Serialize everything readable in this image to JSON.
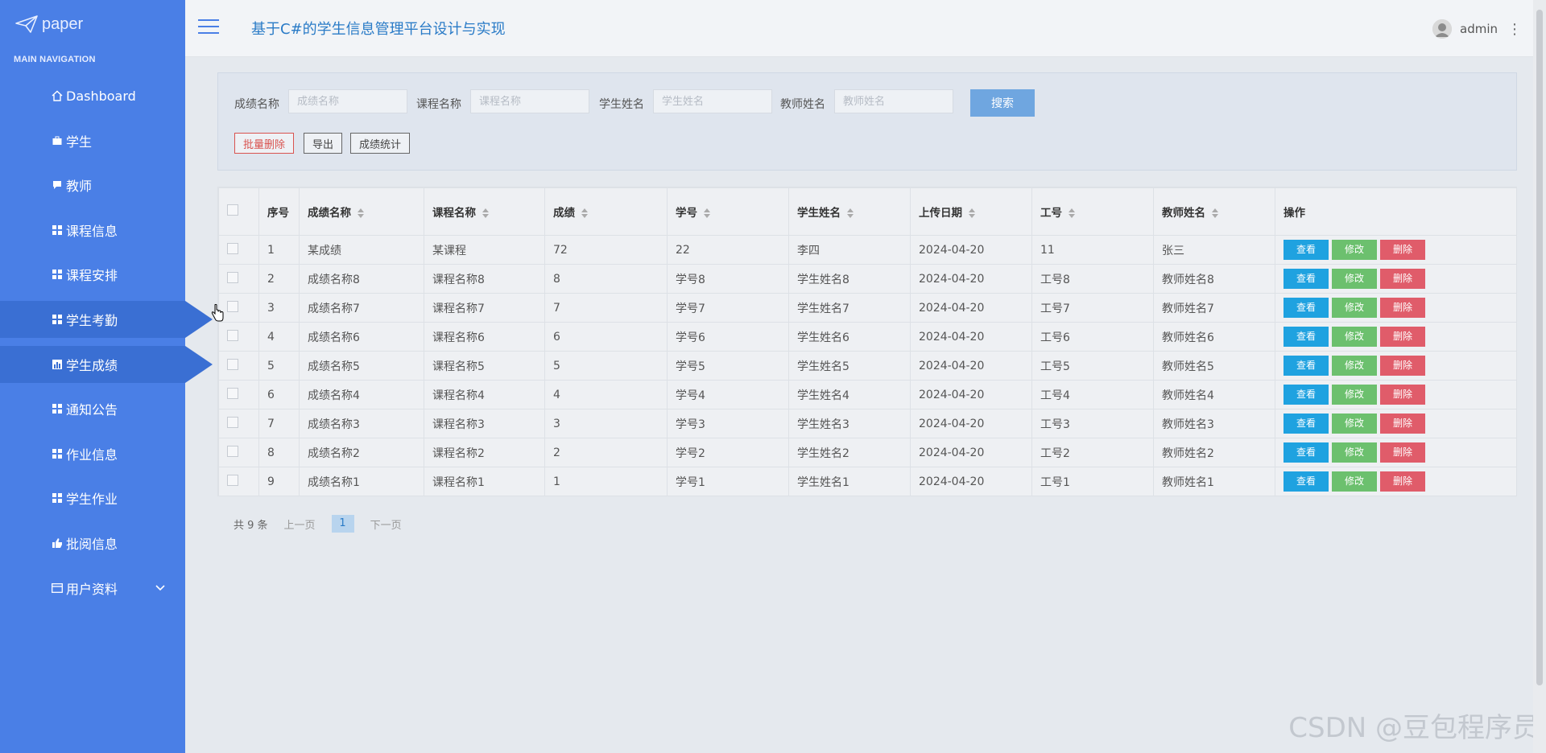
{
  "sidebar": {
    "logo_text": "paper",
    "nav_header": "MAIN NAVIGATION",
    "items": [
      {
        "label": "Dashboard",
        "icon": "home-icon"
      },
      {
        "label": "学生",
        "icon": "briefcase-icon"
      },
      {
        "label": "教师",
        "icon": "chat-icon"
      },
      {
        "label": "课程信息",
        "icon": "grid-icon"
      },
      {
        "label": "课程安排",
        "icon": "grid-icon"
      },
      {
        "label": "学生考勤",
        "icon": "grid-icon",
        "active": true
      },
      {
        "label": "学生成绩",
        "icon": "bar-chart-icon",
        "active": true
      },
      {
        "label": "通知公告",
        "icon": "grid-icon"
      },
      {
        "label": "作业信息",
        "icon": "grid-icon"
      },
      {
        "label": "学生作业",
        "icon": "grid-icon"
      },
      {
        "label": "批阅信息",
        "icon": "thumbs-up-icon"
      },
      {
        "label": "用户资料",
        "icon": "card-icon"
      }
    ]
  },
  "header": {
    "title": "基于C#的学生信息管理平台设计与实现",
    "username": "admin"
  },
  "search": {
    "fields": [
      {
        "label": "成绩名称",
        "placeholder": "成绩名称"
      },
      {
        "label": "课程名称",
        "placeholder": "课程名称"
      },
      {
        "label": "学生姓名",
        "placeholder": "学生姓名"
      },
      {
        "label": "教师姓名",
        "placeholder": "教师姓名"
      }
    ],
    "search_label": "搜索",
    "batch_delete_label": "批量删除",
    "export_label": "导出",
    "stats_label": "成绩统计"
  },
  "table": {
    "columns": [
      "序号",
      "成绩名称",
      "课程名称",
      "成绩",
      "学号",
      "学生姓名",
      "上传日期",
      "工号",
      "教师姓名",
      "操作"
    ],
    "rows": [
      [
        "1",
        "某成绩",
        "某课程",
        "72",
        "22",
        "李四",
        "2024-04-20",
        "11",
        "张三"
      ],
      [
        "2",
        "成绩名称8",
        "课程名称8",
        "8",
        "学号8",
        "学生姓名8",
        "2024-04-20",
        "工号8",
        "教师姓名8"
      ],
      [
        "3",
        "成绩名称7",
        "课程名称7",
        "7",
        "学号7",
        "学生姓名7",
        "2024-04-20",
        "工号7",
        "教师姓名7"
      ],
      [
        "4",
        "成绩名称6",
        "课程名称6",
        "6",
        "学号6",
        "学生姓名6",
        "2024-04-20",
        "工号6",
        "教师姓名6"
      ],
      [
        "5",
        "成绩名称5",
        "课程名称5",
        "5",
        "学号5",
        "学生姓名5",
        "2024-04-20",
        "工号5",
        "教师姓名5"
      ],
      [
        "6",
        "成绩名称4",
        "课程名称4",
        "4",
        "学号4",
        "学生姓名4",
        "2024-04-20",
        "工号4",
        "教师姓名4"
      ],
      [
        "7",
        "成绩名称3",
        "课程名称3",
        "3",
        "学号3",
        "学生姓名3",
        "2024-04-20",
        "工号3",
        "教师姓名3"
      ],
      [
        "8",
        "成绩名称2",
        "课程名称2",
        "2",
        "学号2",
        "学生姓名2",
        "2024-04-20",
        "工号2",
        "教师姓名2"
      ],
      [
        "9",
        "成绩名称1",
        "课程名称1",
        "1",
        "学号1",
        "学生姓名1",
        "2024-04-20",
        "工号1",
        "教师姓名1"
      ]
    ],
    "actions": {
      "view": "查看",
      "edit": "修改",
      "delete": "删除"
    }
  },
  "pagination": {
    "total": "共 9 条",
    "prev": "上一页",
    "current": "1",
    "next": "下一页"
  },
  "watermark": "CSDN @豆包程序员",
  "colors": {
    "sidebar": "#4a7fe6",
    "sidebar_active": "#3a6fd3",
    "title": "#2a7bc7",
    "view": "#1fa2e0",
    "edit": "#6cc06e",
    "delete": "#e05c6a"
  }
}
